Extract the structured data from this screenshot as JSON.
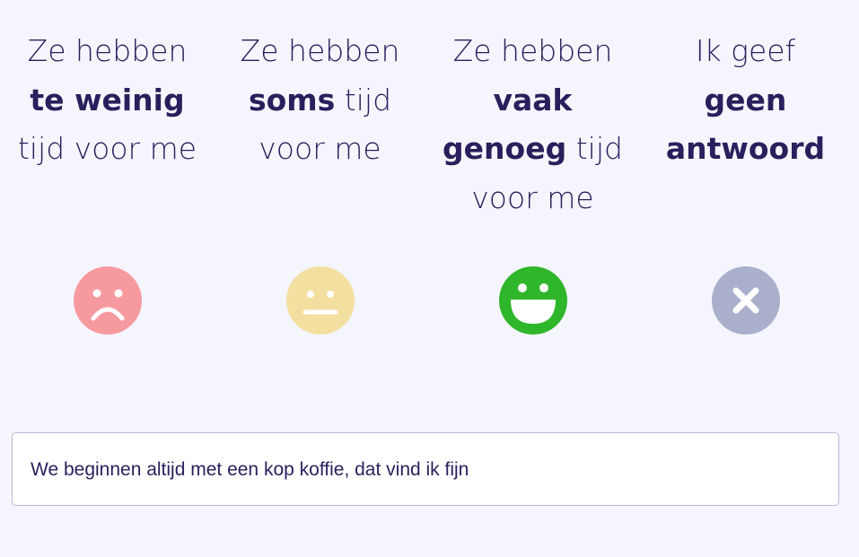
{
  "options": [
    {
      "lines": [
        {
          "pre": "Ze hebben",
          "bold": "",
          "post": ""
        },
        {
          "pre": "",
          "bold": "te weinig",
          "post": ""
        },
        {
          "pre": "tijd voor me",
          "bold": "",
          "post": ""
        }
      ],
      "icon": "sad-face-icon",
      "color": "#f79aa0"
    },
    {
      "lines": [
        {
          "pre": "Ze hebben",
          "bold": "",
          "post": ""
        },
        {
          "pre": "",
          "bold": "soms",
          "post": " tijd"
        },
        {
          "pre": "voor me",
          "bold": "",
          "post": ""
        }
      ],
      "icon": "neutral-face-icon",
      "color": "#f3dfa0"
    },
    {
      "lines": [
        {
          "pre": "Ze hebben",
          "bold": "",
          "post": ""
        },
        {
          "pre": "",
          "bold": "vaak",
          "post": ""
        },
        {
          "pre": "",
          "bold": "genoeg",
          "post": " tijd"
        },
        {
          "pre": "voor me",
          "bold": "",
          "post": ""
        }
      ],
      "icon": "happy-face-icon",
      "color": "#2fb62a"
    },
    {
      "lines": [
        {
          "pre": "Ik geef",
          "bold": "",
          "post": ""
        },
        {
          "pre": "",
          "bold": "geen",
          "post": ""
        },
        {
          "pre": "",
          "bold": "antwoord",
          "post": ""
        }
      ],
      "icon": "no-answer-x-icon",
      "color": "#aab0cc"
    }
  ],
  "comment": {
    "value": "We beginnen altijd met een kop koffie, dat vind ik fijn"
  }
}
